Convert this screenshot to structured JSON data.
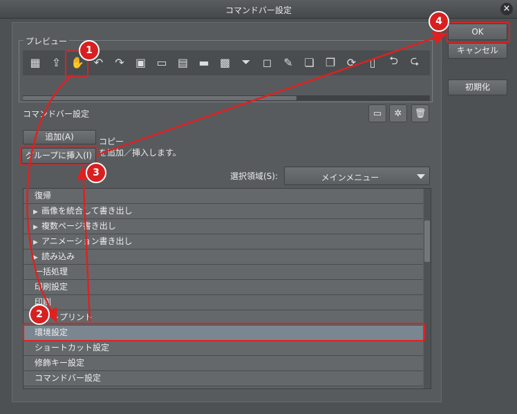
{
  "window": {
    "title": "コマンドバー設定"
  },
  "preview": {
    "label": "プレビュー"
  },
  "toolbar_icons": [
    "grid-icon",
    "image-export-icon",
    "hand-tool-icon",
    "undo-icon",
    "redo-icon",
    "select-all-icon",
    "deselect-icon",
    "invert-selection-icon",
    "ruler-icon",
    "transparency-icon",
    "filter-icon",
    "eraser-icon",
    "pen-icon",
    "layer-icon",
    "layer-merge-icon",
    "rotate-icon",
    "copy-icon",
    "undo-arrow-icon",
    "redo-arrow-icon"
  ],
  "command_bar": {
    "label": "コマンドバー設定"
  },
  "buttons": {
    "add": "追加(A)",
    "insert_group": "グループに挿入(I)",
    "ok": "OK",
    "cancel": "キャンセル",
    "reset": "初期化"
  },
  "info": {
    "line1": "コピー",
    "line2": "を追加／挿入します。"
  },
  "selection": {
    "label": "選択領域(S):",
    "value": "メインメニュー"
  },
  "list_items": [
    {
      "label": "復帰",
      "arrow": false
    },
    {
      "label": "画像を統合して書き出し",
      "arrow": true
    },
    {
      "label": "複数ページ書き出し",
      "arrow": true
    },
    {
      "label": "アニメーション書き出し",
      "arrow": true
    },
    {
      "label": "読み込み",
      "arrow": true
    },
    {
      "label": "一括処理",
      "arrow": false
    },
    {
      "label": "印刷設定",
      "arrow": false
    },
    {
      "label": "印刷",
      "arrow": false
    },
    {
      "label": "ネットプリント",
      "arrow": false
    },
    {
      "label": "環境設定",
      "arrow": false,
      "selected": true
    },
    {
      "label": "ショートカット設定",
      "arrow": false
    },
    {
      "label": "修飾キー設定",
      "arrow": false
    },
    {
      "label": "コマンドバー設定",
      "arrow": false
    }
  ],
  "annotations": {
    "step1": "1",
    "step2": "2",
    "step3": "3",
    "step4": "4"
  },
  "colors": {
    "highlight": "#e02020",
    "selected_row": "#7a8690"
  }
}
